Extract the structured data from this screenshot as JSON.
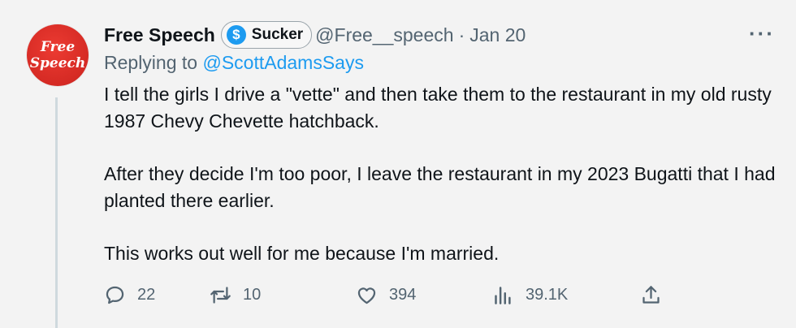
{
  "avatar": {
    "line1": "Free",
    "line2": "Speech"
  },
  "author": {
    "name": "Free Speech",
    "badge_label": "Sucker",
    "badge_icon": "$",
    "handle": "@Free__speech",
    "separator": "·",
    "date": "Jan 20"
  },
  "more_label": "···",
  "replying": {
    "prefix": "Replying to",
    "mention": "@ScottAdamsSays"
  },
  "body": {
    "paragraph1": "I tell the girls I drive a \"vette\" and then take them to the restaurant in my old rusty 1987 Chevy Chevette hatchback.",
    "paragraph2": "After they decide I'm too poor, I leave the restaurant in my 2023 Bugatti that I had planted there earlier.",
    "paragraph3": "This works out well for me because I'm married."
  },
  "actions": {
    "reply_count": "22",
    "retweet_count": "10",
    "like_count": "394",
    "views_count": "39.1K"
  },
  "colors": {
    "background": "#f3f3f3",
    "accent": "#1d9bf0",
    "secondary_text": "#536471",
    "avatar_red": "#d52a24"
  },
  "icons": {
    "reply": "reply-icon",
    "retweet": "retweet-icon",
    "like": "heart-icon",
    "views": "views-icon",
    "share": "share-icon",
    "more": "more-icon"
  }
}
